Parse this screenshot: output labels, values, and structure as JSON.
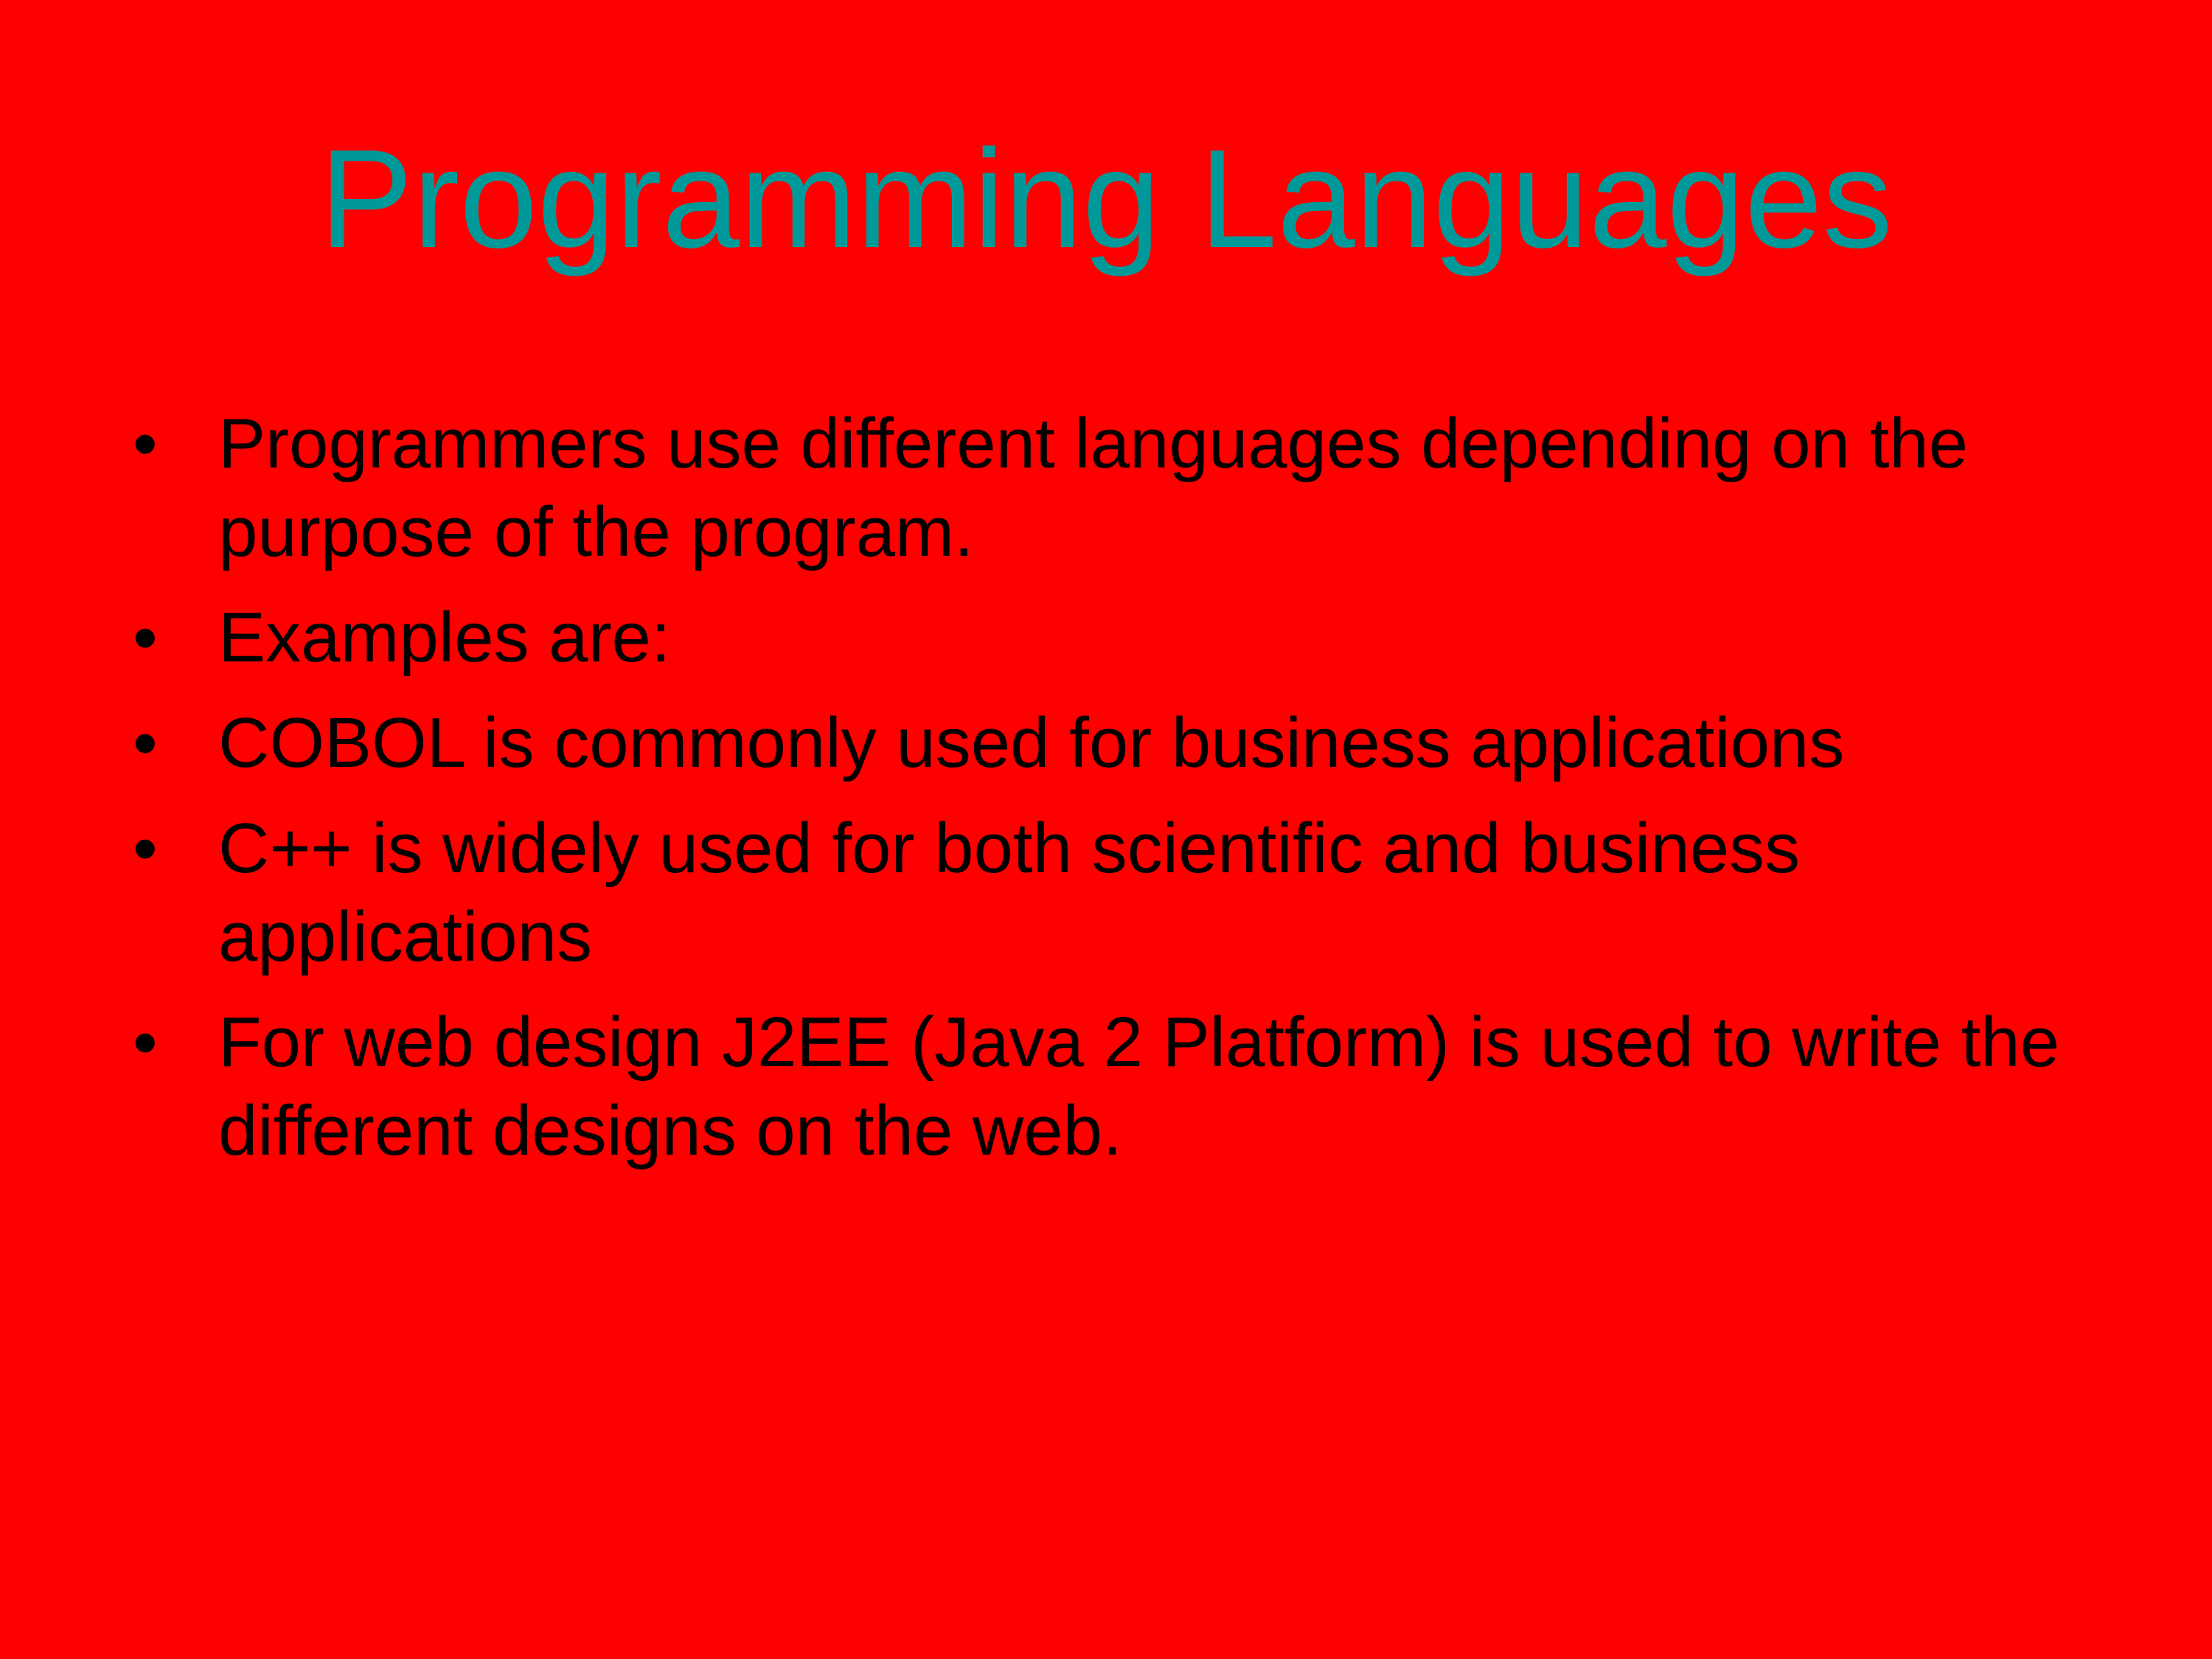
{
  "slide": {
    "title": "Programming Languages",
    "bullet_glyph": "•",
    "bullets": [
      "Programmers use different languages depending on the purpose of the program.",
      "Examples are:",
      "COBOL is commonly used for business applications",
      "C++ is widely used for both scientific and business applications",
      "For web design J2EE (Java 2 Platform) is used to write the different designs on the web."
    ]
  },
  "colors": {
    "background": "#ff0000",
    "title": "#009999",
    "text": "#000000"
  }
}
